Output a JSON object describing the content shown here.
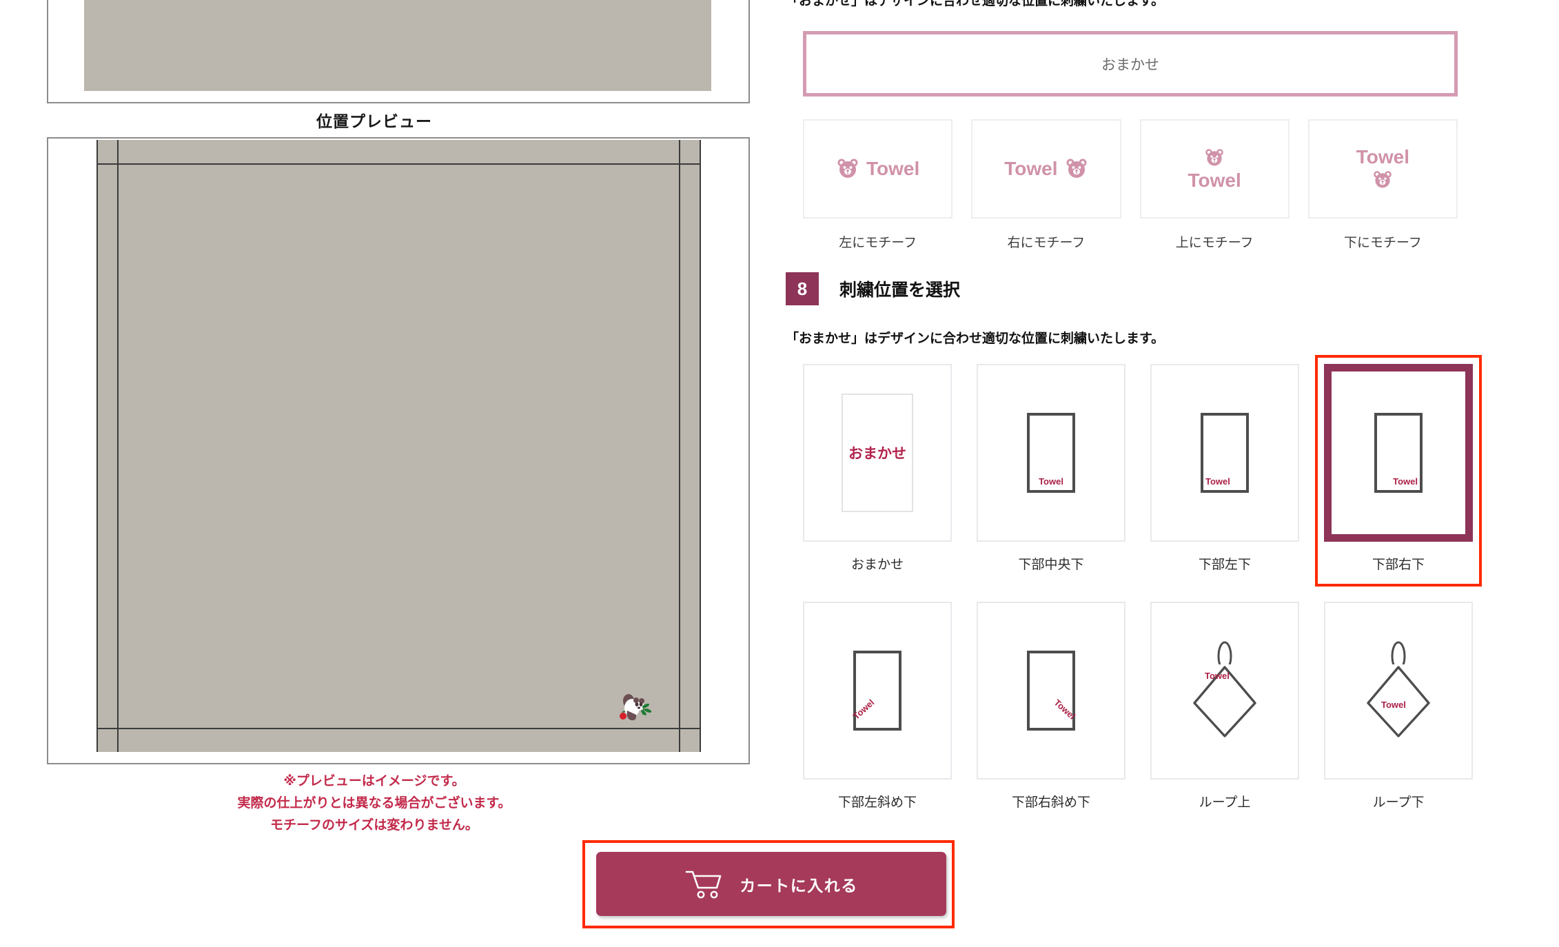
{
  "colors": {
    "wine": "#8e3458",
    "cart_button": "#a63a5b",
    "pink_border": "#d49bb2",
    "motif_pink": "#d092a9",
    "annotation_red": "#ff2a00",
    "note_red": "#c2294a",
    "towel_grey": "#bbb7ae",
    "sketch_stroke": "#4d4d4d",
    "sketch_label_red": "#aa2146"
  },
  "left_panel": {
    "preview_title": "位置プレビュー",
    "motif_name": "panda-motif",
    "notes": [
      "※プレビューはイメージです。",
      "実際の仕上がりとは異なる場合がございます。",
      "モチーフのサイズは変わりません。"
    ],
    "cart_button": {
      "label": "カートに入れる",
      "icon": "shopping-cart-icon"
    }
  },
  "motif_section": {
    "hint": "「おまかせ」はデザインに合わせ適切な位置に刺繍いたします。",
    "omakase_label": "おまかせ",
    "word": "Towel",
    "cards": [
      {
        "caption": "左にモチーフ",
        "layout": "icon-left"
      },
      {
        "caption": "右にモチーフ",
        "layout": "icon-right"
      },
      {
        "caption": "上にモチーフ",
        "layout": "icon-top"
      },
      {
        "caption": "下にモチーフ",
        "layout": "icon-bottom"
      }
    ]
  },
  "embroidery_section": {
    "step_number": "8",
    "title": "刺繍位置を選択",
    "hint": "「おまかせ」はデザインに合わせ適切な位置に刺繍いたします。",
    "omakase_label": "おまかせ",
    "word": "Towel",
    "cards": [
      {
        "caption": "おまかせ",
        "kind": "omakase",
        "selected": false
      },
      {
        "caption": "下部中央下",
        "kind": "rect-bc",
        "selected": false
      },
      {
        "caption": "下部左下",
        "kind": "rect-bl",
        "selected": false
      },
      {
        "caption": "下部右下",
        "kind": "rect-br",
        "selected": true
      },
      {
        "caption": "下部左斜め下",
        "kind": "rect-diag-l",
        "selected": false
      },
      {
        "caption": "下部右斜め下",
        "kind": "rect-diag-r",
        "selected": false
      },
      {
        "caption": "ループ上",
        "kind": "loop-up",
        "selected": false
      },
      {
        "caption": "ループ下",
        "kind": "loop-down",
        "selected": false
      }
    ]
  }
}
